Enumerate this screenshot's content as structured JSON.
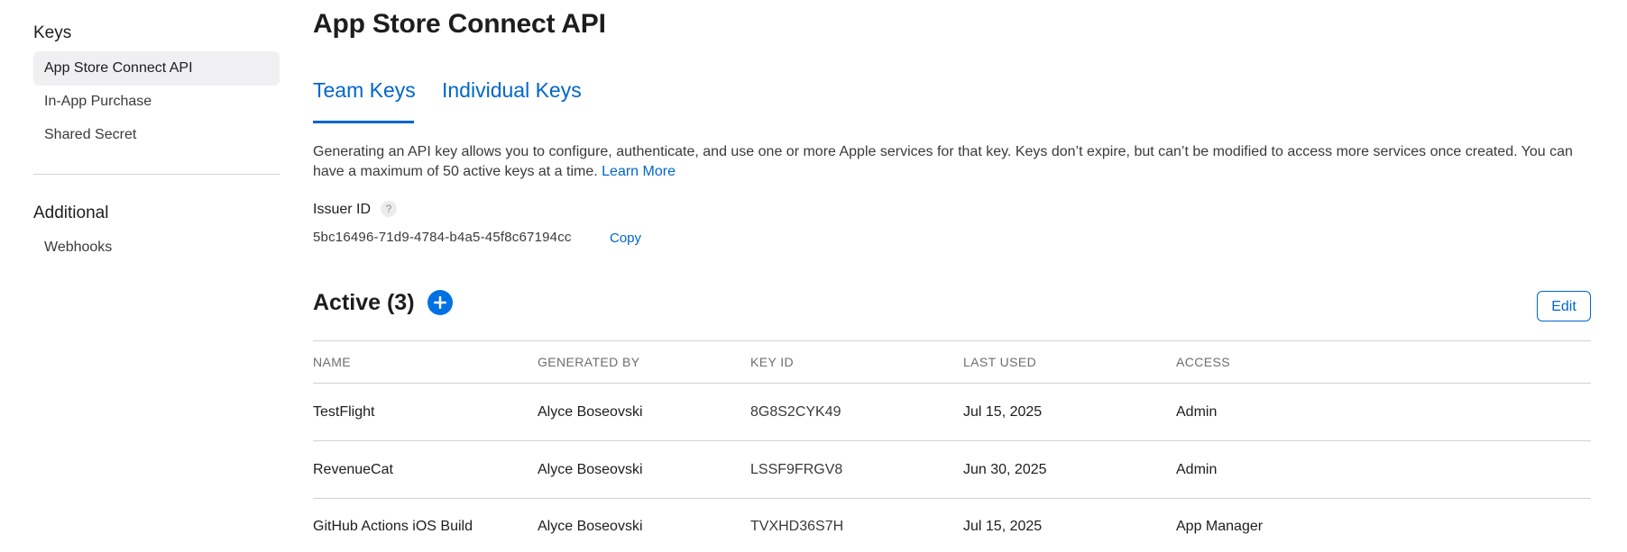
{
  "sidebar": {
    "sections": [
      {
        "heading": "Keys",
        "items": [
          {
            "label": "App Store Connect API",
            "active": true
          },
          {
            "label": "In-App Purchase",
            "active": false
          },
          {
            "label": "Shared Secret",
            "active": false
          }
        ]
      },
      {
        "heading": "Additional",
        "items": [
          {
            "label": "Webhooks",
            "active": false
          }
        ]
      }
    ]
  },
  "main": {
    "title": "App Store Connect API",
    "tabs": [
      {
        "label": "Team Keys",
        "selected": true
      },
      {
        "label": "Individual Keys",
        "selected": false
      }
    ],
    "description": "Generating an API key allows you to configure, authenticate, and use one or more Apple services for that key. Keys don’t expire, but can’t be modified to access more services once created. You can have a maximum of 50 active keys at a time.",
    "learn_more_label": "Learn More",
    "issuer": {
      "label": "Issuer ID",
      "help_symbol": "?",
      "value": "5bc16496-71d9-4784-b4a5-45f8c67194cc",
      "copy_label": "Copy"
    },
    "active_section": {
      "title": "Active (3)",
      "add_icon": "plus-circle-icon",
      "edit_label": "Edit"
    },
    "table": {
      "columns": [
        "NAME",
        "GENERATED BY",
        "KEY ID",
        "LAST USED",
        "ACCESS"
      ],
      "rows": [
        {
          "name": "TestFlight",
          "generated_by": "Alyce Boseovski",
          "key_id": "8G8S2CYK49",
          "last_used": "Jul 15, 2025",
          "access": "Admin"
        },
        {
          "name": "RevenueCat",
          "generated_by": "Alyce Boseovski",
          "key_id": "LSSF9FRGV8",
          "last_used": "Jun 30, 2025",
          "access": "Admin"
        },
        {
          "name": "GitHub Actions iOS Build",
          "generated_by": "Alyce Boseovski",
          "key_id": "TVXHD36S7H",
          "last_used": "Jul 15, 2025",
          "access": "App Manager"
        }
      ]
    }
  },
  "colors": {
    "accent": "#0066cc",
    "add_button": "#0071e3",
    "divider": "#d2d2d7",
    "active_item_bg": "#f0f0f2"
  }
}
